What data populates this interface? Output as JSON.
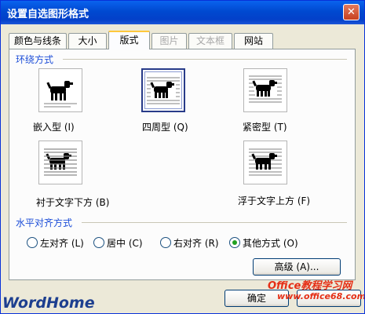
{
  "dialog": {
    "title": "设置自选图形格式",
    "close_glyph": "✕"
  },
  "tabs": [
    {
      "label": "颜色与线条",
      "active": false,
      "disabled": false
    },
    {
      "label": "大小",
      "active": false,
      "disabled": false
    },
    {
      "label": "版式",
      "active": true,
      "disabled": false
    },
    {
      "label": "图片",
      "active": false,
      "disabled": true
    },
    {
      "label": "文本框",
      "active": false,
      "disabled": true
    },
    {
      "label": "网站",
      "active": false,
      "disabled": false
    }
  ],
  "wrap": {
    "section_label": "环绕方式",
    "options": [
      {
        "label": "嵌入型 (I)",
        "icon": "wrap-inline-icon",
        "selected": false
      },
      {
        "label": "四周型 (Q)",
        "icon": "wrap-square-icon",
        "selected": true
      },
      {
        "label": "紧密型 (T)",
        "icon": "wrap-tight-icon",
        "selected": false
      },
      {
        "label": "衬于文字下方 (B)",
        "icon": "wrap-behind-text-icon",
        "selected": false
      },
      {
        "label": "浮于文字上方 (F)",
        "icon": "wrap-in-front-of-text-icon",
        "selected": false
      }
    ]
  },
  "halign": {
    "section_label": "水平对齐方式",
    "options": [
      {
        "label": "左对齐 (L)",
        "checked": false
      },
      {
        "label": "居中 (C)",
        "checked": false
      },
      {
        "label": "右对齐 (R)",
        "checked": false
      },
      {
        "label": "其他方式 (O)",
        "checked": true
      }
    ]
  },
  "buttons": {
    "advanced": "高级 (A)...",
    "ok": "确定"
  },
  "watermarks": {
    "left": "WordHome",
    "right_top": "Office教程学习网",
    "right_bottom": "www.office68.com"
  },
  "colors": {
    "title_bar": "#0049d0",
    "section_text": "#1d4ed8",
    "dialog_bg": "#ece9d8",
    "selected_border": "#283b89",
    "radio_dot": "#21a121"
  }
}
